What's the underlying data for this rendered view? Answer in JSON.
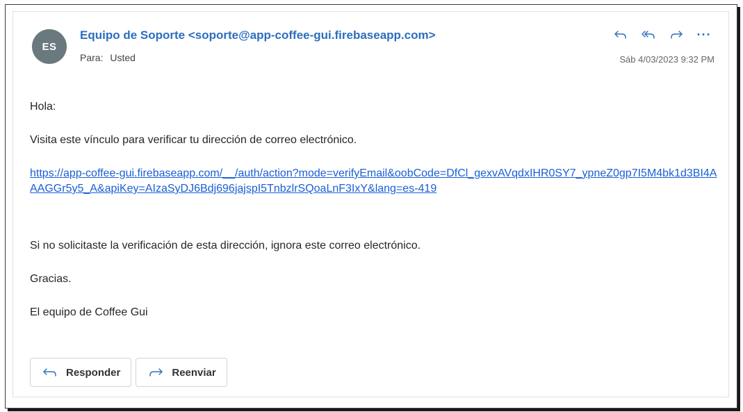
{
  "email": {
    "avatar_initials": "ES",
    "sender": "Equipo de Soporte <soporte@app-coffee-gui.firebaseapp.com>",
    "to_label": "Para:",
    "to_value": "Usted",
    "date": "Sáb 4/03/2023 9:32 PM",
    "actions": [
      {
        "name": "reply",
        "icon": "reply-icon"
      },
      {
        "name": "reply-all",
        "icon": "reply-all-icon"
      },
      {
        "name": "forward",
        "icon": "forward-icon"
      },
      {
        "name": "more",
        "icon": "more-icon",
        "label": "···"
      }
    ],
    "body": {
      "greeting": "Hola:",
      "line1": "Visita este vínculo para verificar tu dirección de correo electrónico.",
      "link": "https://app-coffee-gui.firebaseapp.com/__/auth/action?mode=verifyEmail&oobCode=DfCl_gexvAVqdxIHR0SY7_ypneZ0gp7I5M4bk1d3BI4AAAGGr5y5_A&apiKey=AIzaSyDJ6Bdj696jajspI5TnbzlrSQoaLnF3IxY&lang=es-419",
      "line2": "Si no solicitaste la verificación de esta dirección, ignora este correo electrónico.",
      "thanks": "Gracias.",
      "signature": "El equipo de Coffee Gui"
    },
    "buttons": {
      "reply_label": "Responder",
      "forward_label": "Reenviar"
    }
  },
  "colors": {
    "accent": "#2b6ebd",
    "link": "#1a5fd6",
    "avatar_bg": "#69797e"
  }
}
